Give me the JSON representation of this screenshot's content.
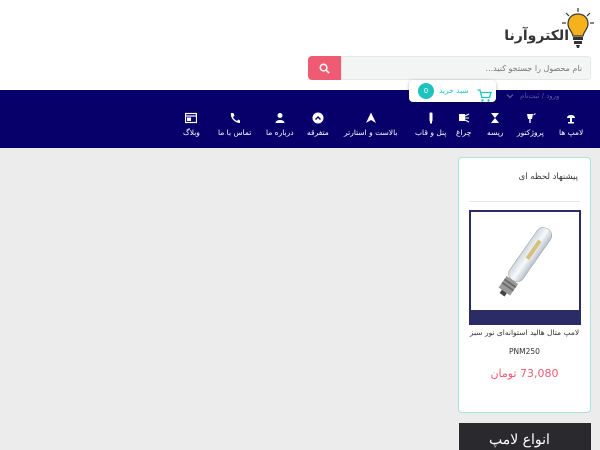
{
  "brand": {
    "name": "الکتروآرنا",
    "accent": "#ef5b73",
    "teal": "#1ec3bd",
    "nav_bg": "#07006b"
  },
  "search": {
    "placeholder": "نام محصول را جستجو کنید..."
  },
  "account": {
    "login_label": "ورود / ثبت‌نام"
  },
  "cart": {
    "label": "سبد خرید",
    "count": "0"
  },
  "menu": [
    {
      "label": "لامپ ها",
      "icon": "lamp-icon"
    },
    {
      "label": "پروژکتور",
      "icon": "floodlight-icon"
    },
    {
      "label": "ریسه",
      "icon": "hourglass-icon"
    },
    {
      "label": "چراغ",
      "icon": "spotlight-icon"
    },
    {
      "label": "پنل و قاب",
      "icon": "tube-icon"
    },
    {
      "label": "بالاست و استارتر",
      "icon": "ballast-icon"
    },
    {
      "label": "متفرقه",
      "icon": "circle-chevron-icon"
    },
    {
      "label": "درباره ما",
      "icon": "person-icon"
    },
    {
      "label": "تماس با ما",
      "icon": "phone-icon"
    },
    {
      "label": "وبلاگ",
      "icon": "blog-icon"
    }
  ],
  "offer": {
    "title": "پیشنهاد لحظه ای",
    "product_name": "لامپ متال هالید استوانه‌ای نور سبز",
    "product_code": "PNM250",
    "price": "73,080 تومان"
  },
  "banner": {
    "text": "انواع لامپ"
  }
}
